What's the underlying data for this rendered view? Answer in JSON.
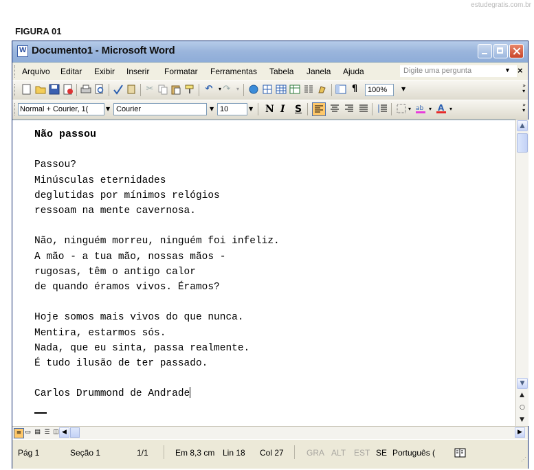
{
  "watermark": "estudegratis.com.br",
  "figure_label": "FIGURA 01",
  "window": {
    "title": "Documento1 - Microsoft Word"
  },
  "menu": {
    "items": [
      "Arquivo",
      "Editar",
      "Exibir",
      "Inserir",
      "Formatar",
      "Ferramentas",
      "Tabela",
      "Janela",
      "Ajuda"
    ],
    "ask_placeholder": "Digite uma pergunta"
  },
  "toolbar": {
    "zoom": "100%",
    "style": "Normal + Courier, 1(",
    "font": "Courier",
    "size": "10",
    "bold_label": "N",
    "italic_label": "I",
    "underline_label": "S"
  },
  "document": {
    "title": "Não passou",
    "stanzas": [
      [
        "Passou?",
        "Minúsculas eternidades",
        "deglutidas por mínimos relógios",
        "ressoam na mente cavernosa."
      ],
      [
        "Não, ninguém morreu, ninguém foi infeliz.",
        "A mão - a tua mão, nossas mãos -",
        "rugosas, têm o antigo calor",
        "de quando éramos vivos. Éramos?"
      ],
      [
        "Hoje somos mais vivos do que nunca.",
        "Mentira, estarmos sós.",
        "Nada, que eu sinta, passa realmente.",
        "É tudo ilusão de ter passado."
      ]
    ],
    "author": "Carlos Drummond de Andrade"
  },
  "status": {
    "page": "Pág 1",
    "section": "Seção 1",
    "pages": "1/1",
    "at": "Em 8,3 cm",
    "line": "Lin 18",
    "col": "Col 27",
    "rec": "GRA",
    "trk": "ALT",
    "ext": "EST",
    "ovr": "SE",
    "language": "Português ("
  }
}
